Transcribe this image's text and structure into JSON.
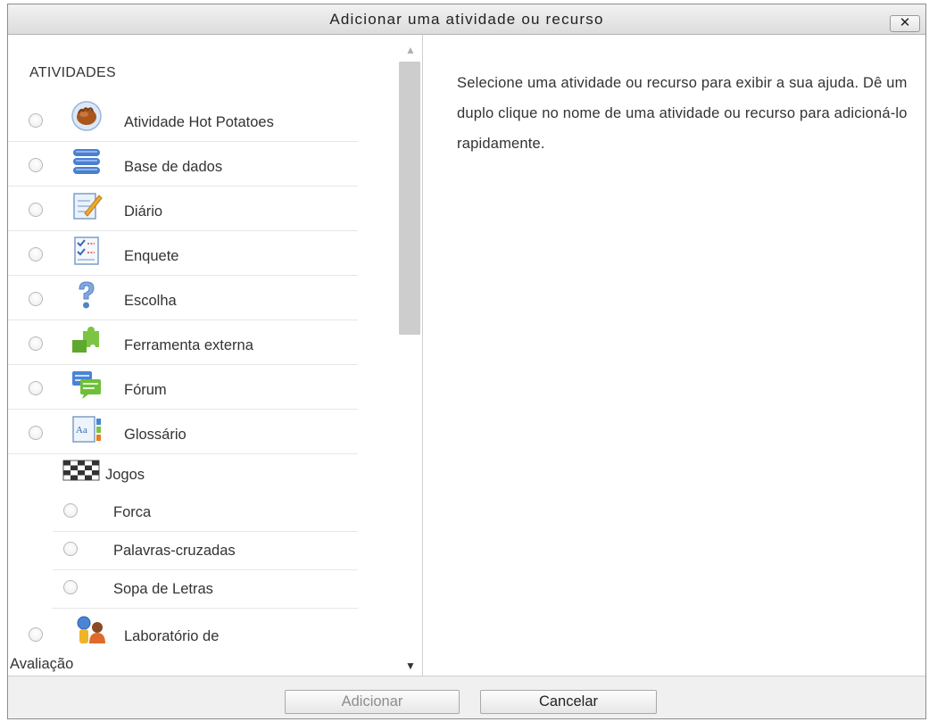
{
  "dialog": {
    "title": "Adicionar uma atividade ou recurso",
    "close_label": "✕"
  },
  "activities": {
    "section_title": "ATIVIDADES",
    "items": [
      {
        "label": "Atividade Hot Potatoes",
        "icon": "hot-potatoes-icon"
      },
      {
        "label": "Base de dados",
        "icon": "database-icon"
      },
      {
        "label": "Diário",
        "icon": "journal-icon"
      },
      {
        "label": "Enquete",
        "icon": "survey-icon"
      },
      {
        "label": "Escolha",
        "icon": "question-mark-icon"
      },
      {
        "label": "Ferramenta externa",
        "icon": "puzzle-icon"
      },
      {
        "label": "Fórum",
        "icon": "forum-icon"
      },
      {
        "label": "Glossário",
        "icon": "glossary-icon"
      }
    ],
    "games_group": {
      "label": "Jogos",
      "icon": "games-icon",
      "items": [
        {
          "label": "Forca"
        },
        {
          "label": "Palavras-cruzadas"
        },
        {
          "label": "Sopa de Letras"
        }
      ]
    },
    "workshop": {
      "label_line1": "Laboratório de",
      "label_line2": "Avaliação",
      "icon": "workshop-icon"
    }
  },
  "help": {
    "text": "Selecione uma atividade ou recurso para exibir a sua ajuda. Dê um duplo clique no nome de uma atividade ou recurso para adicioná-lo rapidamente."
  },
  "footer": {
    "add_label": "Adicionar",
    "add_enabled": false,
    "cancel_label": "Cancelar"
  },
  "colors": {
    "title_bar": "#e6e6e6",
    "footer_bg": "#f0f0f0",
    "scroll_thumb": "#cdcdcd",
    "disabled_text": "#8d8d8d"
  }
}
